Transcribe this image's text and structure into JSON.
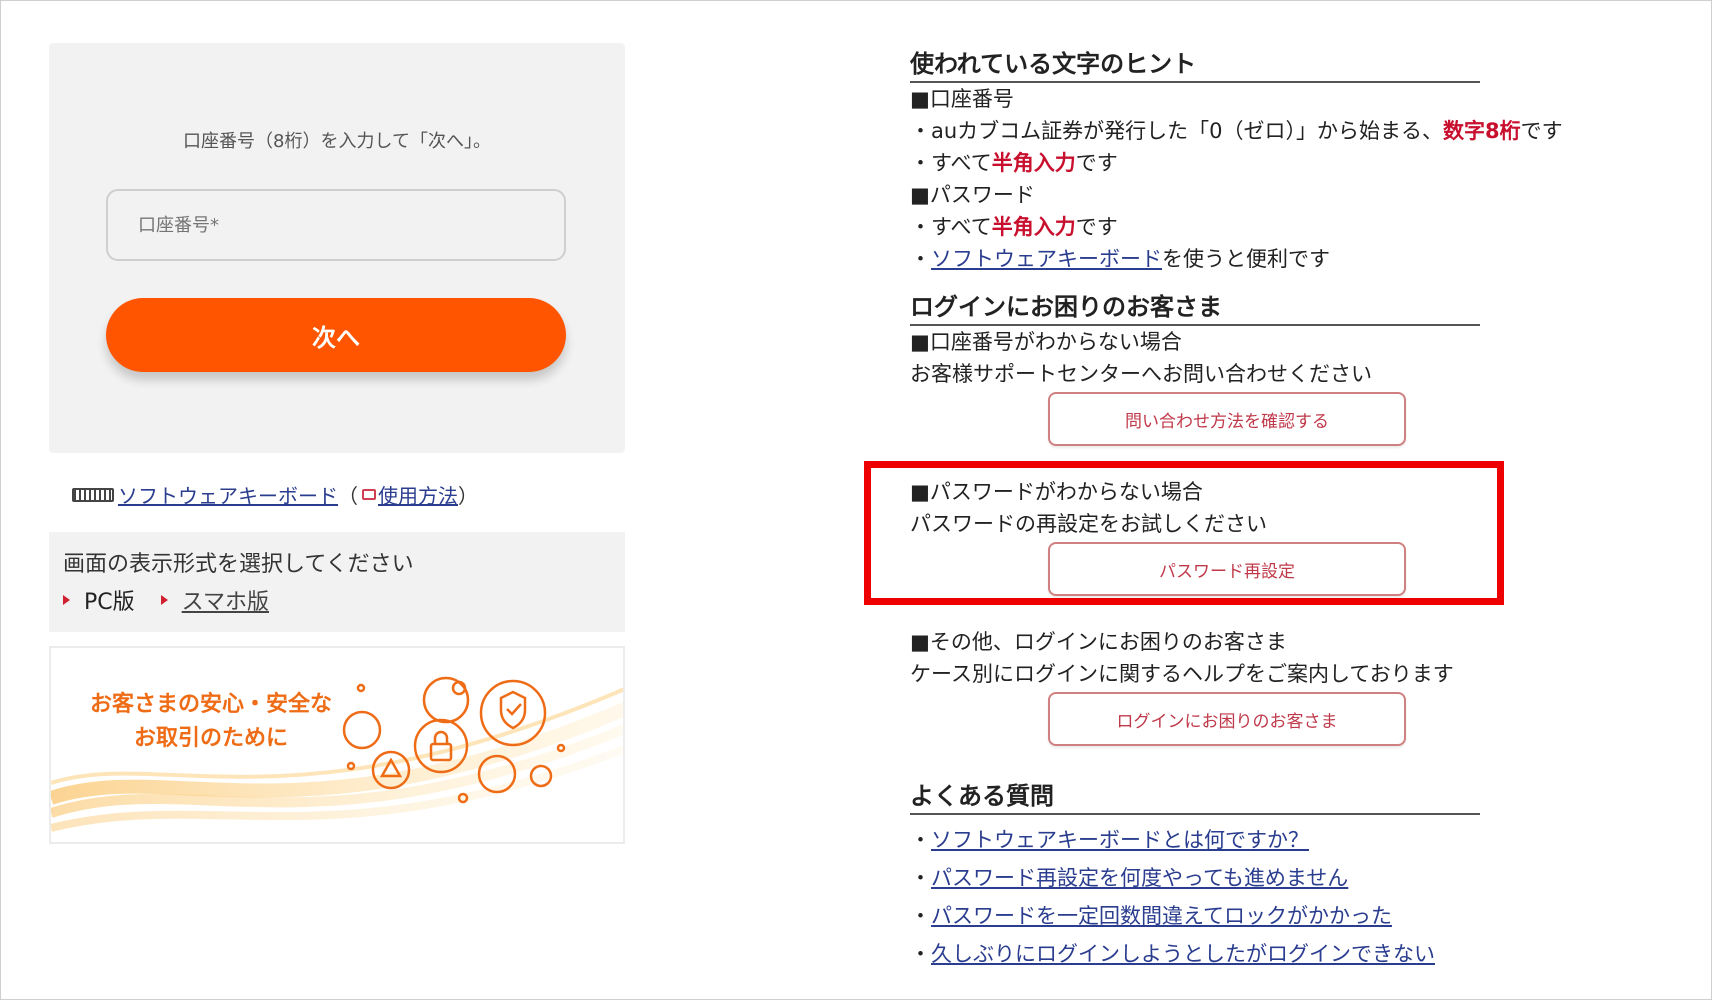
{
  "login": {
    "instruction": "口座番号（8桁）を入力して「次へ」。",
    "account_placeholder": "口座番号*",
    "next_label": "次へ"
  },
  "keyboard_row": {
    "software_keyboard_link": "ソフトウェアキーボード",
    "open_paren": "（",
    "usage_link": "使用方法",
    "close_paren": "）"
  },
  "display_mode": {
    "title": "画面の表示形式を選択してください",
    "pc_label": "PC版",
    "smartphone_label": "スマホ版"
  },
  "banner": {
    "line1": "お客さまの安心・安全な",
    "line2": "お取引のために"
  },
  "hints": {
    "heading": "使われている文字のヒント",
    "account_heading": "■口座番号",
    "account_line1_pre": "・auカブコム証券が発行した「0（ゼロ）」から始まる、",
    "account_line1_red": "数字8桁",
    "account_line1_post": "です",
    "account_line2_pre": "・すべて",
    "account_line2_red": "半角入力",
    "account_line2_post": "です",
    "password_heading": "■パスワード",
    "password_line1_pre": "・すべて",
    "password_line1_red": "半角入力",
    "password_line1_post": "です",
    "password_line2_pre": "・",
    "password_line2_link": "ソフトウェアキーボード",
    "password_line2_post": "を使うと便利です"
  },
  "trouble": {
    "heading": "ログインにお困りのお客さま",
    "account_unknown_heading": "■口座番号がわからない場合",
    "account_unknown_text": "お客様サポートセンターへお問い合わせください",
    "contact_button": "問い合わせ方法を確認する",
    "password_unknown_heading": "■パスワードがわからない場合",
    "password_unknown_text": "パスワードの再設定をお試しください",
    "password_reset_button": "パスワード再設定",
    "other_heading": "■その他、ログインにお困りのお客さま",
    "other_text": "ケース別にログインに関するヘルプをご案内しております",
    "login_help_button": "ログインにお困りのお客さま"
  },
  "faq": {
    "heading": "よくある質問",
    "items": [
      "ソフトウェアキーボードとは何ですか？",
      "パスワード再設定を何度やっても進めません",
      "パスワードを一定回数間違えてロックがかかった",
      "久しぶりにログインしようとしたがログインできない"
    ]
  },
  "colors": {
    "accent_orange": "#ff5500",
    "emphasis_red": "#c8102e",
    "highlight_red": "#ee0000",
    "link_blue": "#2a3d8f"
  }
}
